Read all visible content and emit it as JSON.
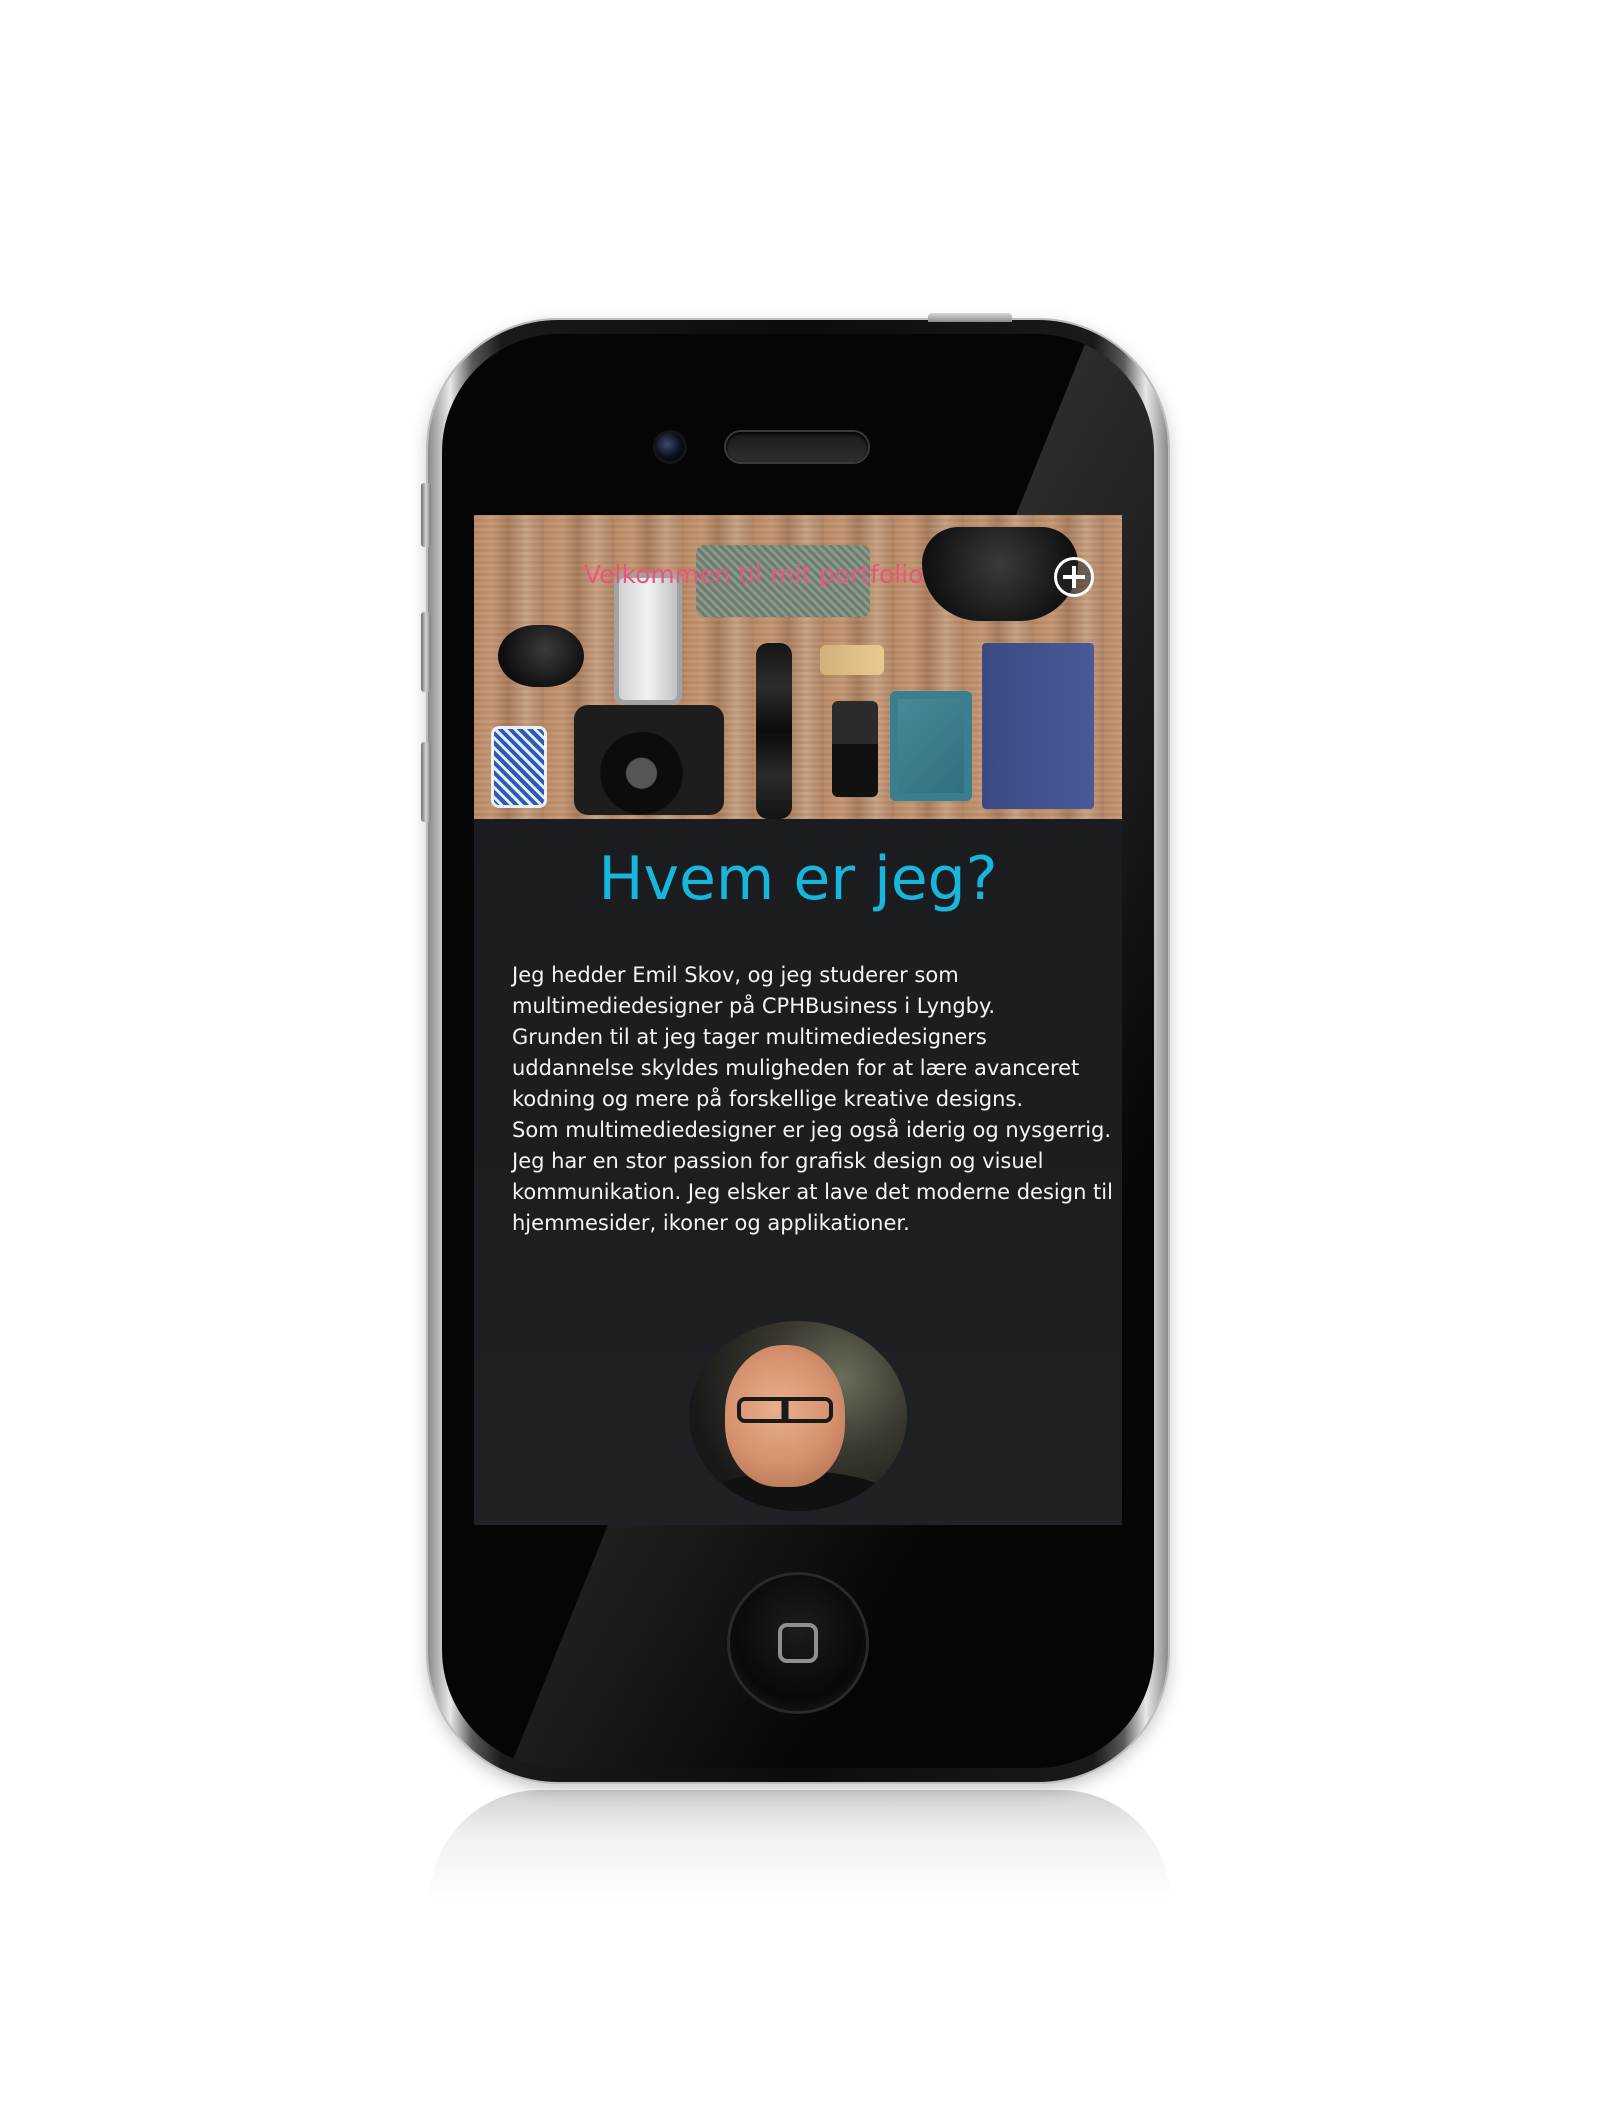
{
  "site": {
    "header_title": "Velkommen til mit portfolio",
    "menu_toggle_icon": "plus-circle-icon"
  },
  "about": {
    "heading": "Hvem er jeg?",
    "bio": "Jeg hedder Emil Skov, og jeg studerer som multimediedesigner på CPHBusiness i Lyngby.\n Grunden til at jeg tager multimediedesigners uddannelse skyldes muligheden for at lære avanceret kodning og mere på forskellige kreative designs.\n Som multimediedesigner er jeg også iderig og nysgerrig. Jeg har en stor passion for grafisk design og visuel kommunikation. Jeg elsker at lave det moderne design til hjemmesider, ikoner og applikationer."
  },
  "colors": {
    "header_title": "#f0527c",
    "heading": "#17b6dc",
    "screen_background": "#1b1d20",
    "body_text": "#f4f4f4"
  }
}
